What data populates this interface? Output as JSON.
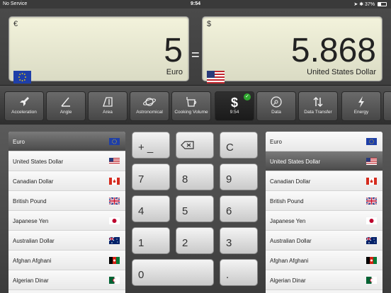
{
  "status": {
    "carrier": "No Service",
    "time": "9:54",
    "battery": "37%",
    "battery_level": 0.37
  },
  "from": {
    "symbol": "€",
    "value": "5",
    "name": "Euro",
    "flag": "eu"
  },
  "to": {
    "symbol": "$",
    "value": "5.868",
    "name": "United States Dollar",
    "flag": "us"
  },
  "equals": "=",
  "categories": [
    {
      "label": "Acceleration",
      "icon": "rocket-icon"
    },
    {
      "label": "Angle",
      "icon": "angle-icon"
    },
    {
      "label": "Area",
      "icon": "area-icon"
    },
    {
      "label": "Astronomical",
      "icon": "planet-icon"
    },
    {
      "label": "Cooking Volume",
      "icon": "cup-icon"
    },
    {
      "label": "9:54",
      "icon": "dollar-icon"
    },
    {
      "label": "Data",
      "icon": "disc-icon"
    },
    {
      "label": "Data Transfer",
      "icon": "transfer-arrows-icon"
    },
    {
      "label": "Energy",
      "icon": "lightning-icon"
    }
  ],
  "from_list": [
    {
      "label": "Euro",
      "flag": "eu"
    },
    {
      "label": "United States Dollar",
      "flag": "us"
    },
    {
      "label": "Canadian Dollar",
      "flag": "ca"
    },
    {
      "label": "British Pound",
      "flag": "gb"
    },
    {
      "label": "Japanese Yen",
      "flag": "jp"
    },
    {
      "label": "Australian Dollar",
      "flag": "au"
    },
    {
      "label": "Afghan Afghani",
      "flag": "af"
    },
    {
      "label": "Algerian Dinar",
      "flag": "dz"
    }
  ],
  "to_list": [
    {
      "label": "Euro",
      "flag": "eu"
    },
    {
      "label": "United States Dollar",
      "flag": "us"
    },
    {
      "label": "Canadian Dollar",
      "flag": "ca"
    },
    {
      "label": "British Pound",
      "flag": "gb"
    },
    {
      "label": "Japanese Yen",
      "flag": "jp"
    },
    {
      "label": "Australian Dollar",
      "flag": "au"
    },
    {
      "label": "Afghan Afghani",
      "flag": "af"
    },
    {
      "label": "Algerian Dinar",
      "flag": "dz"
    }
  ],
  "keypad": {
    "plusminus": "+ _",
    "clear": "C",
    "k7": "7",
    "k8": "8",
    "k9": "9",
    "k4": "4",
    "k5": "5",
    "k6": "6",
    "k1": "1",
    "k2": "2",
    "k3": "3",
    "k0": "0",
    "dot": "."
  }
}
